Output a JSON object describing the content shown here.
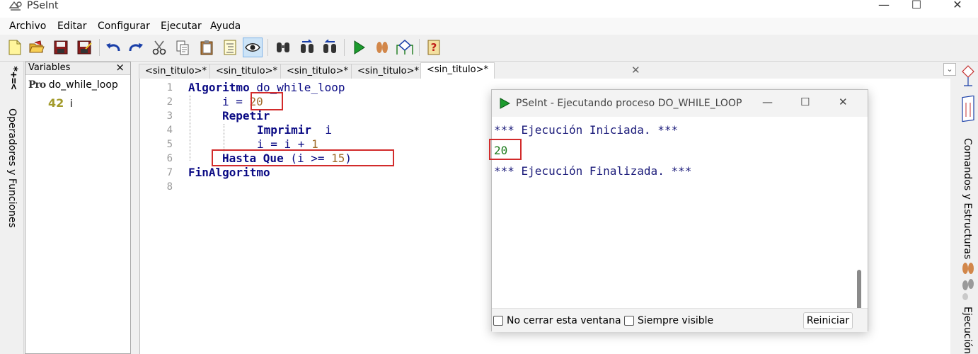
{
  "window": {
    "title": "PSeInt",
    "app_icon": "pseint-logo-icon",
    "controls": [
      "minimize-icon",
      "maximize-icon",
      "close-icon"
    ]
  },
  "menu": {
    "items": [
      "Archivo",
      "Editar",
      "Configurar",
      "Ejecutar",
      "Ayuda"
    ]
  },
  "toolbar": {
    "buttons": [
      "new-file-icon",
      "open-folder-icon",
      "save-icon",
      "save-as-icon",
      "undo-icon",
      "redo-icon",
      "cut-icon",
      "copy-icon",
      "paste-icon",
      "indent-icon",
      "eye-icon",
      "find-icon",
      "find-next-icon",
      "replace-icon",
      "run-icon",
      "step-icon",
      "flowchart-icon",
      "help-icon"
    ]
  },
  "left_strip": {
    "symbols": "*+=<",
    "label": "Operadores y Funciones"
  },
  "variables_panel": {
    "title": "Variables",
    "close": "×",
    "process_badge": "Pro",
    "process_name": "do_while_loop",
    "var_type_badge": "42",
    "var_name": "i"
  },
  "tabs": {
    "items": [
      "<sin_titulo>*",
      "<sin_titulo>*",
      "<sin_titulo>*",
      "<sin_titulo>*",
      "<sin_titulo>*"
    ],
    "close": "✕",
    "dropdown": "⌄"
  },
  "editor": {
    "line_numbers": [
      "1",
      "2",
      "3",
      "4",
      "5",
      "6",
      "7",
      "8"
    ],
    "tokens": {
      "l1_kw": "Algoritmo",
      "l1_id": " do_while_loop",
      "l2_id": "i",
      "l2_op": " = ",
      "l2_num": "20",
      "l3_kw": "Repetir",
      "l4_kw": "Imprimir",
      "l4_id": "  i",
      "l5_id": "i",
      "l5_op": " = i + ",
      "l5_num": "1",
      "l6_kw": "Hasta Que",
      "l6_op": " (i >= ",
      "l6_num": "15",
      "l6_close": ")",
      "l7_kw": "FinAlgoritmo"
    }
  },
  "right_strip": {
    "commands_label": "Comandos y Estructuras",
    "execution_label": "Ejecución"
  },
  "run_dialog": {
    "title": "PSeInt - Ejecutando proceso DO_WHILE_LOOP",
    "console": {
      "line1": "*** Ejecución Iniciada. ***",
      "line2": "20",
      "line3": "*** Ejecución Finalizada. ***"
    },
    "footer": {
      "keep_open": "No cerrar esta ventana",
      "always_visible": "Siempre visible",
      "restart": "Reiniciar"
    }
  },
  "colors": {
    "keyword": "#0a0a84",
    "number": "#a06c2a",
    "output_green": "#1a7a1a",
    "highlight_red": "#d22b2b",
    "active_tool": "#cde4f7"
  }
}
